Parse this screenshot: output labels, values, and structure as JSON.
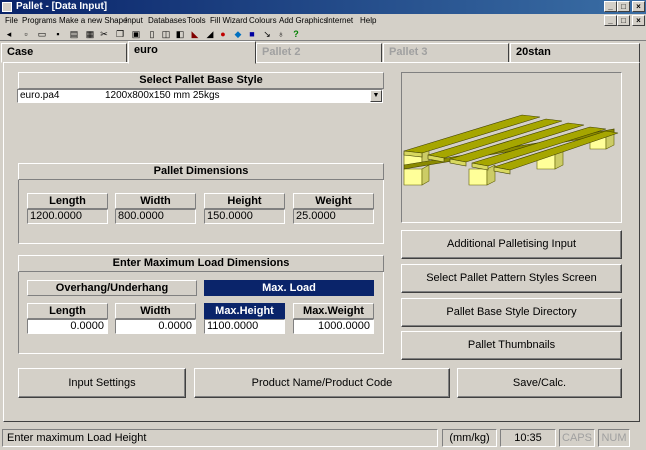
{
  "window": {
    "title": "Pallet - [Data Input]"
  },
  "menu": [
    "File",
    "Programs",
    "Make a new Shape",
    "Input",
    "Databases",
    "Tools",
    "Fill Wizard",
    "Colours",
    "Add Graphics",
    "Internet",
    "Help"
  ],
  "toolbar": {
    "back_label": "back"
  },
  "tabs": [
    {
      "label": "Case",
      "state": "normal"
    },
    {
      "label": "euro",
      "state": "active"
    },
    {
      "label": "Pallet 2",
      "state": "disabled"
    },
    {
      "label": "Pallet 3",
      "state": "disabled"
    },
    {
      "label": "20stan",
      "state": "normal"
    }
  ],
  "base_style": {
    "header": "Select Pallet Base Style",
    "selected_name": "euro.pa4",
    "selected_desc": "1200x800x150 mm 25kgs"
  },
  "dimensions": {
    "header": "Pallet Dimensions",
    "fields": [
      {
        "label": "Length",
        "value": "1200.0000"
      },
      {
        "label": "Width",
        "value": "800.0000"
      },
      {
        "label": "Height",
        "value": "150.0000"
      },
      {
        "label": "Weight",
        "value": "25.0000"
      }
    ]
  },
  "max_load": {
    "header": "Enter Maximum Load Dimensions",
    "overhang_label": "Overhang/Underhang",
    "max_load_label": "Max. Load",
    "fields": [
      {
        "label": "Length",
        "value": "0.0000"
      },
      {
        "label": "Width",
        "value": "0.0000"
      },
      {
        "label": "Max.Height",
        "value": "1100.0000"
      },
      {
        "label": "Max.Weight",
        "value": "1000.0000"
      }
    ]
  },
  "right_buttons": [
    "Additional Palletising Input",
    "Select Pallet Pattern Styles Screen",
    "Pallet Base Style Directory",
    "Pallet Thumbnails"
  ],
  "bottom_buttons": [
    "Input Settings",
    "Product Name/Product Code",
    "Save/Calc."
  ],
  "status": {
    "message": "Enter maximum Load Height",
    "units": "(mm/kg)",
    "time": "10:35",
    "caps": "CAPS",
    "num": "NUM"
  },
  "colors": {
    "pallet_top": "#a6a600",
    "pallet_block": "#ffff99",
    "selection": "#0a246a"
  }
}
